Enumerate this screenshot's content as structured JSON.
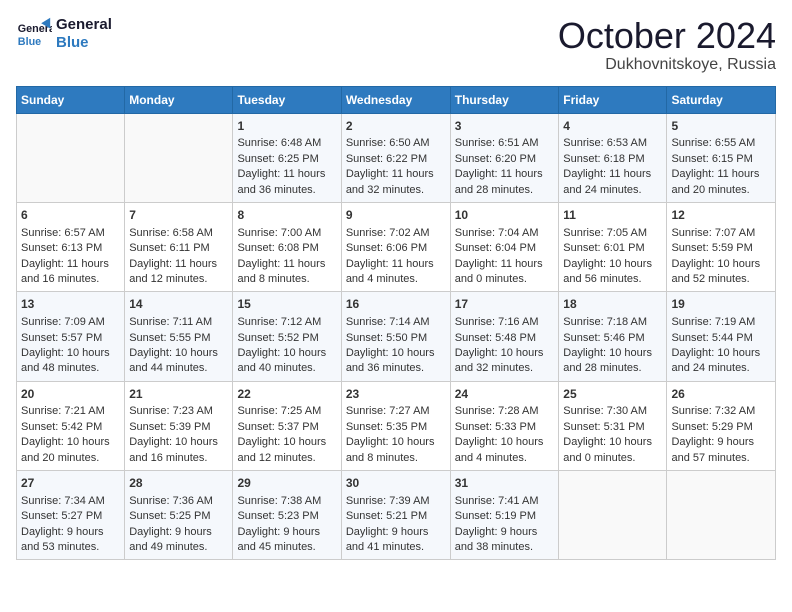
{
  "logo": {
    "line1": "General",
    "line2": "Blue"
  },
  "title": "October 2024",
  "location": "Dukhovnitskoye, Russia",
  "days_header": [
    "Sunday",
    "Monday",
    "Tuesday",
    "Wednesday",
    "Thursday",
    "Friday",
    "Saturday"
  ],
  "weeks": [
    [
      {
        "day": "",
        "sunrise": "",
        "sunset": "",
        "daylight": ""
      },
      {
        "day": "",
        "sunrise": "",
        "sunset": "",
        "daylight": ""
      },
      {
        "day": "1",
        "sunrise": "Sunrise: 6:48 AM",
        "sunset": "Sunset: 6:25 PM",
        "daylight": "Daylight: 11 hours and 36 minutes."
      },
      {
        "day": "2",
        "sunrise": "Sunrise: 6:50 AM",
        "sunset": "Sunset: 6:22 PM",
        "daylight": "Daylight: 11 hours and 32 minutes."
      },
      {
        "day": "3",
        "sunrise": "Sunrise: 6:51 AM",
        "sunset": "Sunset: 6:20 PM",
        "daylight": "Daylight: 11 hours and 28 minutes."
      },
      {
        "day": "4",
        "sunrise": "Sunrise: 6:53 AM",
        "sunset": "Sunset: 6:18 PM",
        "daylight": "Daylight: 11 hours and 24 minutes."
      },
      {
        "day": "5",
        "sunrise": "Sunrise: 6:55 AM",
        "sunset": "Sunset: 6:15 PM",
        "daylight": "Daylight: 11 hours and 20 minutes."
      }
    ],
    [
      {
        "day": "6",
        "sunrise": "Sunrise: 6:57 AM",
        "sunset": "Sunset: 6:13 PM",
        "daylight": "Daylight: 11 hours and 16 minutes."
      },
      {
        "day": "7",
        "sunrise": "Sunrise: 6:58 AM",
        "sunset": "Sunset: 6:11 PM",
        "daylight": "Daylight: 11 hours and 12 minutes."
      },
      {
        "day": "8",
        "sunrise": "Sunrise: 7:00 AM",
        "sunset": "Sunset: 6:08 PM",
        "daylight": "Daylight: 11 hours and 8 minutes."
      },
      {
        "day": "9",
        "sunrise": "Sunrise: 7:02 AM",
        "sunset": "Sunset: 6:06 PM",
        "daylight": "Daylight: 11 hours and 4 minutes."
      },
      {
        "day": "10",
        "sunrise": "Sunrise: 7:04 AM",
        "sunset": "Sunset: 6:04 PM",
        "daylight": "Daylight: 11 hours and 0 minutes."
      },
      {
        "day": "11",
        "sunrise": "Sunrise: 7:05 AM",
        "sunset": "Sunset: 6:01 PM",
        "daylight": "Daylight: 10 hours and 56 minutes."
      },
      {
        "day": "12",
        "sunrise": "Sunrise: 7:07 AM",
        "sunset": "Sunset: 5:59 PM",
        "daylight": "Daylight: 10 hours and 52 minutes."
      }
    ],
    [
      {
        "day": "13",
        "sunrise": "Sunrise: 7:09 AM",
        "sunset": "Sunset: 5:57 PM",
        "daylight": "Daylight: 10 hours and 48 minutes."
      },
      {
        "day": "14",
        "sunrise": "Sunrise: 7:11 AM",
        "sunset": "Sunset: 5:55 PM",
        "daylight": "Daylight: 10 hours and 44 minutes."
      },
      {
        "day": "15",
        "sunrise": "Sunrise: 7:12 AM",
        "sunset": "Sunset: 5:52 PM",
        "daylight": "Daylight: 10 hours and 40 minutes."
      },
      {
        "day": "16",
        "sunrise": "Sunrise: 7:14 AM",
        "sunset": "Sunset: 5:50 PM",
        "daylight": "Daylight: 10 hours and 36 minutes."
      },
      {
        "day": "17",
        "sunrise": "Sunrise: 7:16 AM",
        "sunset": "Sunset: 5:48 PM",
        "daylight": "Daylight: 10 hours and 32 minutes."
      },
      {
        "day": "18",
        "sunrise": "Sunrise: 7:18 AM",
        "sunset": "Sunset: 5:46 PM",
        "daylight": "Daylight: 10 hours and 28 minutes."
      },
      {
        "day": "19",
        "sunrise": "Sunrise: 7:19 AM",
        "sunset": "Sunset: 5:44 PM",
        "daylight": "Daylight: 10 hours and 24 minutes."
      }
    ],
    [
      {
        "day": "20",
        "sunrise": "Sunrise: 7:21 AM",
        "sunset": "Sunset: 5:42 PM",
        "daylight": "Daylight: 10 hours and 20 minutes."
      },
      {
        "day": "21",
        "sunrise": "Sunrise: 7:23 AM",
        "sunset": "Sunset: 5:39 PM",
        "daylight": "Daylight: 10 hours and 16 minutes."
      },
      {
        "day": "22",
        "sunrise": "Sunrise: 7:25 AM",
        "sunset": "Sunset: 5:37 PM",
        "daylight": "Daylight: 10 hours and 12 minutes."
      },
      {
        "day": "23",
        "sunrise": "Sunrise: 7:27 AM",
        "sunset": "Sunset: 5:35 PM",
        "daylight": "Daylight: 10 hours and 8 minutes."
      },
      {
        "day": "24",
        "sunrise": "Sunrise: 7:28 AM",
        "sunset": "Sunset: 5:33 PM",
        "daylight": "Daylight: 10 hours and 4 minutes."
      },
      {
        "day": "25",
        "sunrise": "Sunrise: 7:30 AM",
        "sunset": "Sunset: 5:31 PM",
        "daylight": "Daylight: 10 hours and 0 minutes."
      },
      {
        "day": "26",
        "sunrise": "Sunrise: 7:32 AM",
        "sunset": "Sunset: 5:29 PM",
        "daylight": "Daylight: 9 hours and 57 minutes."
      }
    ],
    [
      {
        "day": "27",
        "sunrise": "Sunrise: 7:34 AM",
        "sunset": "Sunset: 5:27 PM",
        "daylight": "Daylight: 9 hours and 53 minutes."
      },
      {
        "day": "28",
        "sunrise": "Sunrise: 7:36 AM",
        "sunset": "Sunset: 5:25 PM",
        "daylight": "Daylight: 9 hours and 49 minutes."
      },
      {
        "day": "29",
        "sunrise": "Sunrise: 7:38 AM",
        "sunset": "Sunset: 5:23 PM",
        "daylight": "Daylight: 9 hours and 45 minutes."
      },
      {
        "day": "30",
        "sunrise": "Sunrise: 7:39 AM",
        "sunset": "Sunset: 5:21 PM",
        "daylight": "Daylight: 9 hours and 41 minutes."
      },
      {
        "day": "31",
        "sunrise": "Sunrise: 7:41 AM",
        "sunset": "Sunset: 5:19 PM",
        "daylight": "Daylight: 9 hours and 38 minutes."
      },
      {
        "day": "",
        "sunrise": "",
        "sunset": "",
        "daylight": ""
      },
      {
        "day": "",
        "sunrise": "",
        "sunset": "",
        "daylight": ""
      }
    ]
  ]
}
